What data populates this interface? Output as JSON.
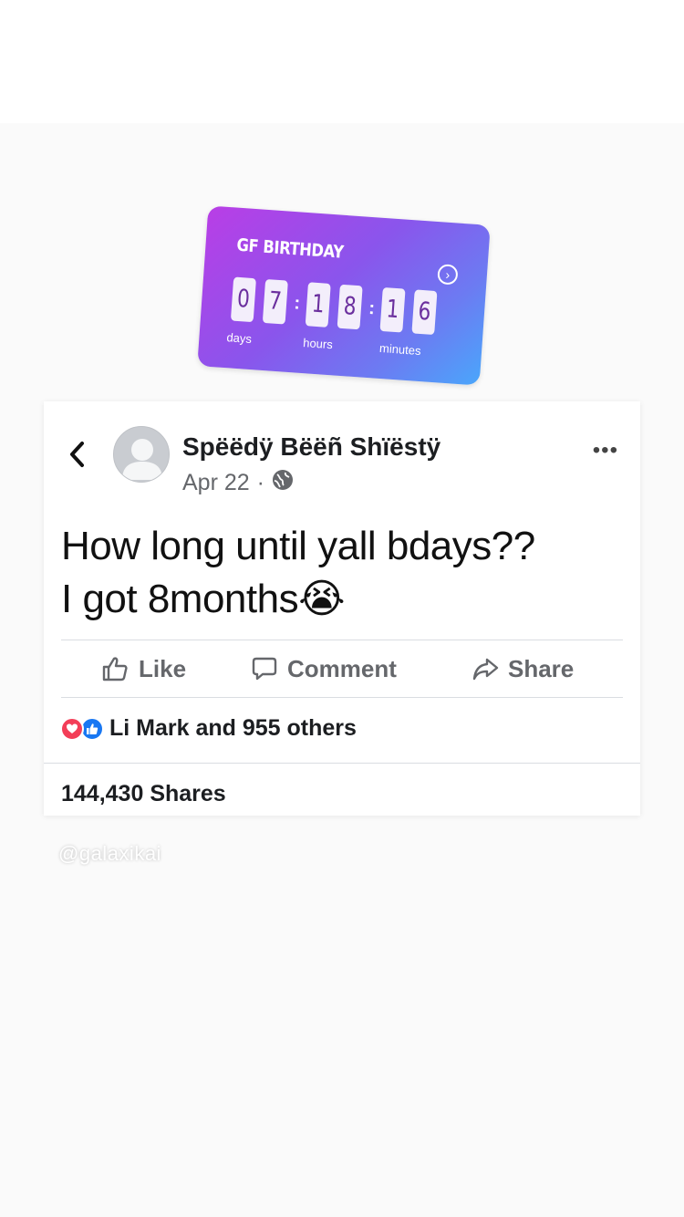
{
  "sticker": {
    "title": "GF BIRTHDAY",
    "digits": [
      "0",
      "7",
      "1",
      "8",
      "1",
      "6"
    ],
    "units": {
      "days": "days",
      "hours": "hours",
      "minutes": "minutes"
    },
    "arrow_glyph": "›"
  },
  "post": {
    "author": "Spëëdÿ Bëëñ Shïëstÿ",
    "date": "Apr 22",
    "dot": "·",
    "text_line1": "How long until yall bdays??",
    "text_line2": "I got 8months",
    "emoji": "😭",
    "more_glyph": "•••",
    "actions": {
      "like": "Like",
      "comment": "Comment",
      "share": "Share"
    },
    "reactions_text": "Li Mark and 955 others",
    "shares_text": "144,430 Shares"
  },
  "watermark": "@galaxikai",
  "colors": {
    "like_blue": "#1877f2",
    "love_red": "#f33e58",
    "muted": "#65676b"
  }
}
